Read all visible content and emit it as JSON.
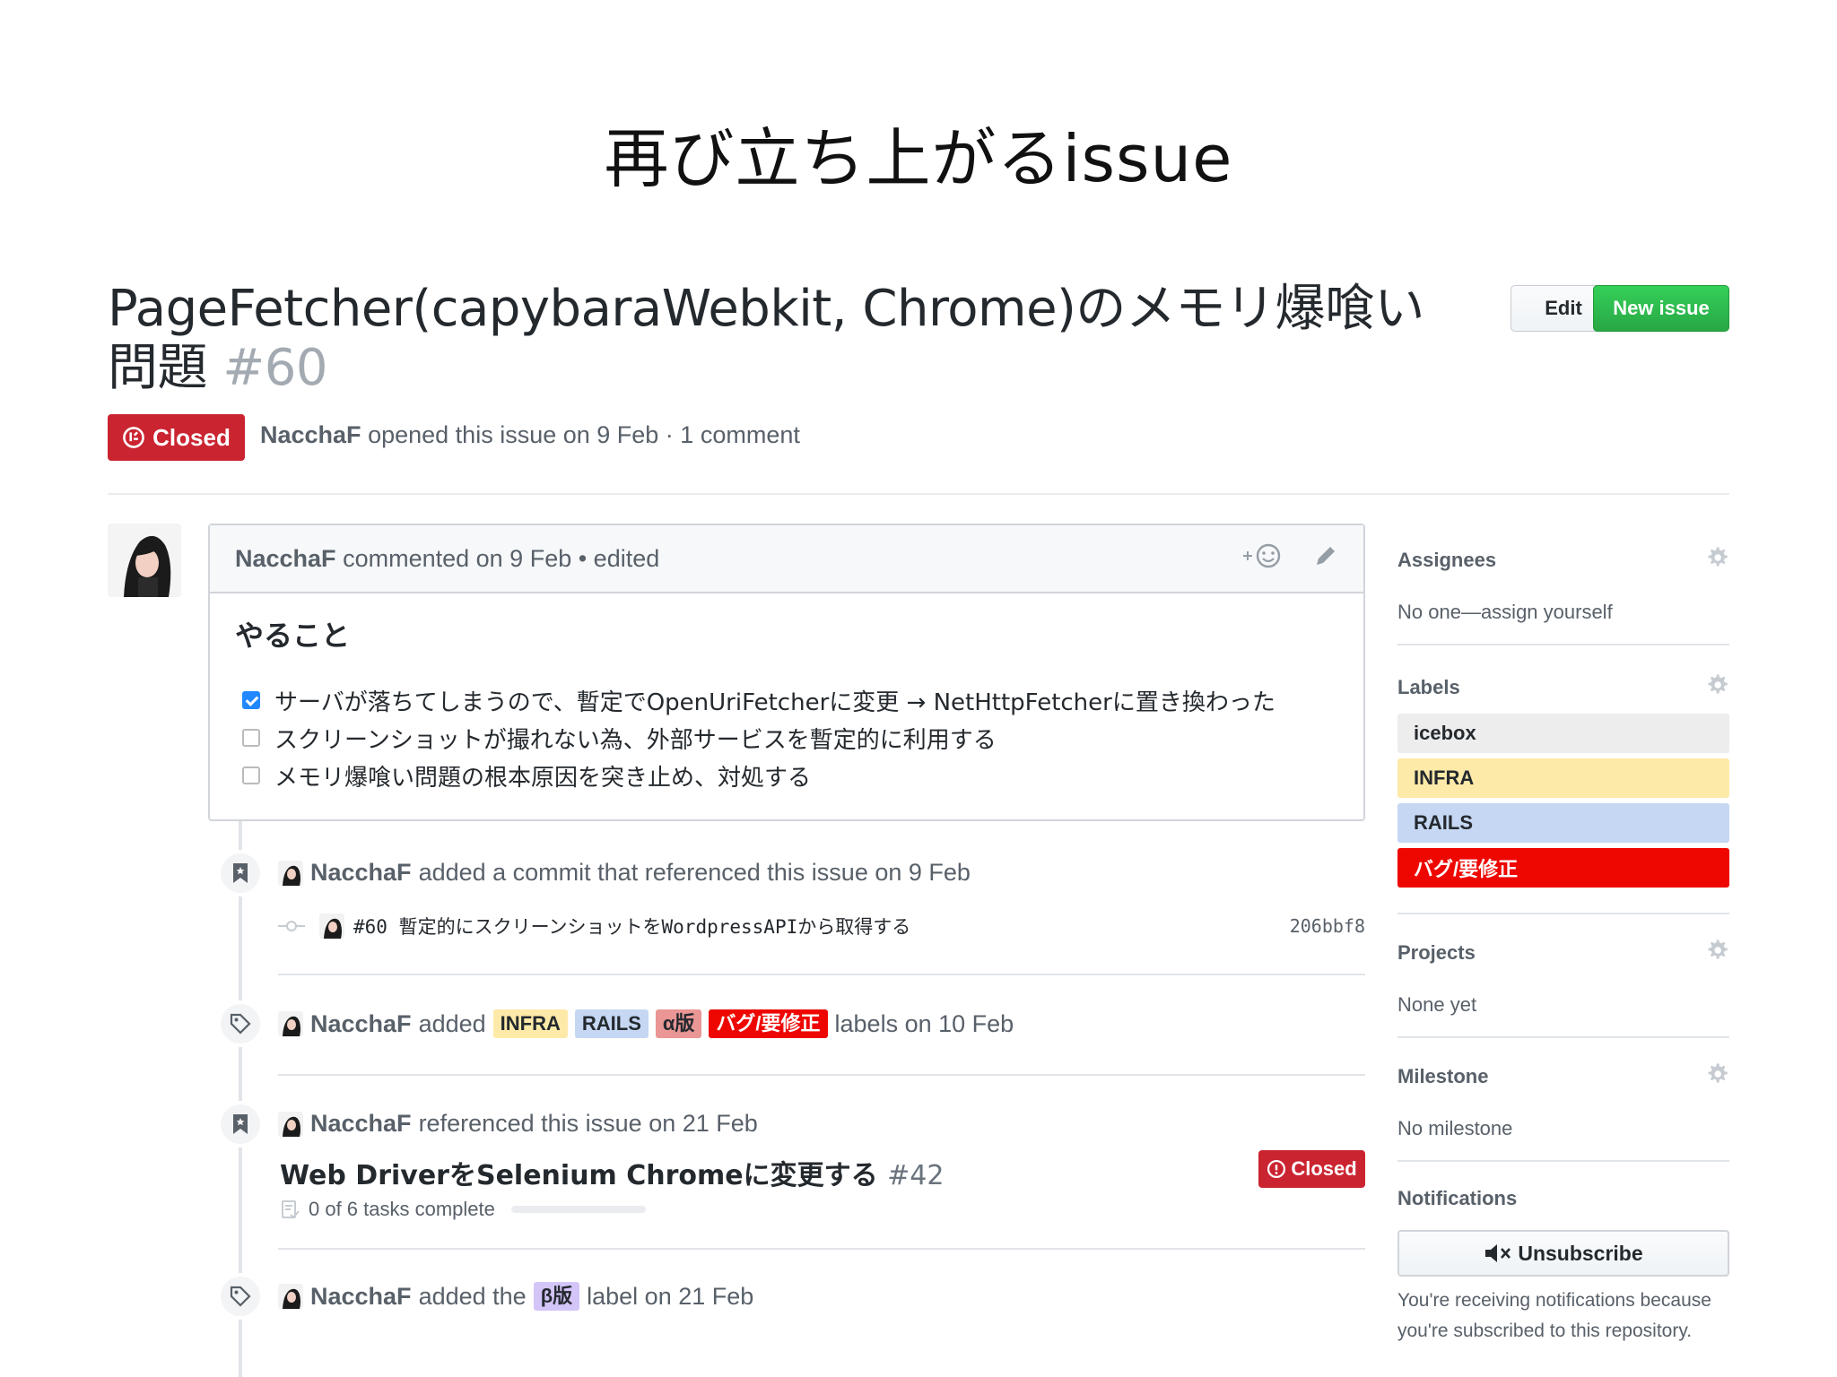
{
  "slide": {
    "title": "再び立ち上がるissue"
  },
  "issue": {
    "title": "PageFetcher(capybaraWebkit, Chrome)のメモリ爆喰い問題",
    "number": "#60",
    "edit_label": "Edit",
    "new_issue_label": "New issue",
    "state": "Closed",
    "author": "NacchaF",
    "meta_text": "opened this issue on 9 Feb · 1 comment"
  },
  "comment": {
    "author": "NacchaF",
    "header_text": "commented on 9 Feb • edited",
    "heading": "やること",
    "tasks": [
      {
        "checked": true,
        "text": "サーバが落ちてしまうので、暫定でOpenUriFetcherに変更 → NetHttpFetcherに置き換わった"
      },
      {
        "checked": false,
        "text": "スクリーンショットが撮れない為、外部サービスを暫定的に利用する"
      },
      {
        "checked": false,
        "text": "メモリ爆喰い問題の根本原因を突き止め、対処する"
      }
    ]
  },
  "timeline": {
    "commit_event": {
      "author": "NacchaF",
      "text": "added a commit that referenced this issue on 9 Feb"
    },
    "commit": {
      "message": "#60 暫定的にスクリーンショットをWordpressAPIから取得する",
      "sha": "206bbf8"
    },
    "labels_event": {
      "author": "NacchaF",
      "pre": "added",
      "post": "labels on 10 Feb",
      "labels": [
        {
          "name": "INFRA",
          "bg": "#fdeaa8",
          "fg": "#24292e"
        },
        {
          "name": "RAILS",
          "bg": "#c5d7f2",
          "fg": "#24292e"
        },
        {
          "name": "α版",
          "bg": "#e99695",
          "fg": "#24292e"
        },
        {
          "name": "バグ/要修正",
          "bg": "#ee0701",
          "fg": "#ffffff"
        }
      ]
    },
    "ref_event": {
      "author": "NacchaF",
      "text": "referenced this issue on 21 Feb"
    },
    "ref_issue": {
      "title": "Web DriverをSelenium Chromeに変更する",
      "number": "#42",
      "state": "Closed",
      "tasks": "0 of 6 tasks complete",
      "progress": 0
    },
    "beta_event": {
      "author": "NacchaF",
      "pre": "added the",
      "label": "β版",
      "label_bg": "#d4c5f9",
      "post": "label on 21 Feb"
    }
  },
  "sidebar": {
    "assignees": {
      "title": "Assignees",
      "value": "No one—assign yourself"
    },
    "labels": {
      "title": "Labels",
      "items": [
        {
          "name": "icebox",
          "bg": "#ededed",
          "fg": "#24292e"
        },
        {
          "name": "INFRA",
          "bg": "#fdeaa8",
          "fg": "#24292e"
        },
        {
          "name": "RAILS",
          "bg": "#c5d7f2",
          "fg": "#24292e"
        },
        {
          "name": "バグ/要修正",
          "bg": "#ee0701",
          "fg": "#ffffff"
        }
      ]
    },
    "projects": {
      "title": "Projects",
      "value": "None yet"
    },
    "milestone": {
      "title": "Milestone",
      "value": "No milestone"
    },
    "notifications": {
      "title": "Notifications",
      "button": "Unsubscribe",
      "text": "You're receiving notifications because you're subscribed to this repository."
    }
  }
}
